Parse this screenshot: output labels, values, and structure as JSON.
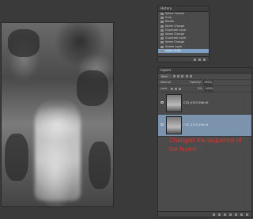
{
  "history": {
    "tab_label": "History",
    "items": [
      {
        "label": "Select Canvas"
      },
      {
        "label": "Crop"
      },
      {
        "label": "Rotate"
      },
      {
        "label": "Name Change"
      },
      {
        "label": "Duplicate Layer"
      },
      {
        "label": "Name Change"
      },
      {
        "label": "Duplicate Layer"
      },
      {
        "label": "Name Change"
      },
      {
        "label": "Delete Layer"
      },
      {
        "label": "Layer Order"
      }
    ]
  },
  "layers": {
    "tab_label": "Layers",
    "kind_label": "Kind",
    "blend_mode": "Normal",
    "opacity_label": "Opacity:",
    "opacity_value": "100%",
    "lock_label": "Lock:",
    "fill_label": "Fill:",
    "fill_value": "100%",
    "items": [
      {
        "name": "CZ5_0315-Edit.tif",
        "selected": false
      },
      {
        "name": "CZ5_0315-Edit.tif",
        "selected": true
      }
    ]
  },
  "annotation": {
    "text": "Changed the sequence of the layers"
  }
}
